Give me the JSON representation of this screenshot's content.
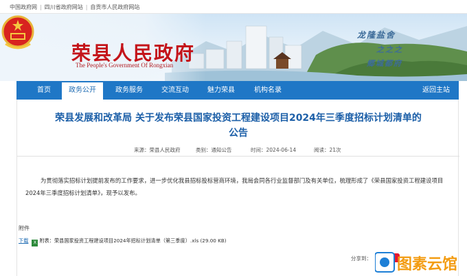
{
  "top_links": [
    {
      "label": "中国政府网"
    },
    {
      "label": "四川省政府网站"
    },
    {
      "label": "自贡市人民政府网站"
    }
  ],
  "banner": {
    "title": "荣县人民政府",
    "subtitle": "The People's Government Of Rongxian",
    "slogan_line1": "龙隆盐舍",
    "slogan_line2": "之之之",
    "slogan_line3": "郷城都府"
  },
  "nav": {
    "items": [
      {
        "label": "首页"
      },
      {
        "label": "政务公开"
      },
      {
        "label": "政务服务"
      },
      {
        "label": "交流互动"
      },
      {
        "label": "魅力荣县"
      },
      {
        "label": "机构名录"
      }
    ],
    "back_label": "返回主站"
  },
  "article": {
    "title_line1": "荣县发展和改革局 关于发布荣县国家投资工程建设项目2024年三季度招标计划清单的",
    "title_line2": "公告",
    "source": "来源：荣县人民政府",
    "category": "类别：通知公告",
    "date": "时间：2024-06-14",
    "views": "阅读：21次",
    "paragraph": "为贯彻落实招标计划提前发布的工作要求，进一步优化我县招标投标营商环境，我局会同各行业监督部门及有关单位，梳理形成了《荣县国家投资工程建设项目2024年三季度招标计划清单》，现予以发布。",
    "attachment_label": "附件",
    "download_label": "下载",
    "attachment_file": "附表：荣县国家投资工程建设项目2024年招标计划清单（第三季度）.xls  (29.00 KB)"
  },
  "share": {
    "label": "分享到："
  },
  "watermark": {
    "text": "图素云馆"
  },
  "colors": {
    "nav_blue": "#1f77c6",
    "title_red": "#c4141a",
    "article_title_blue": "#1c5fa8"
  }
}
